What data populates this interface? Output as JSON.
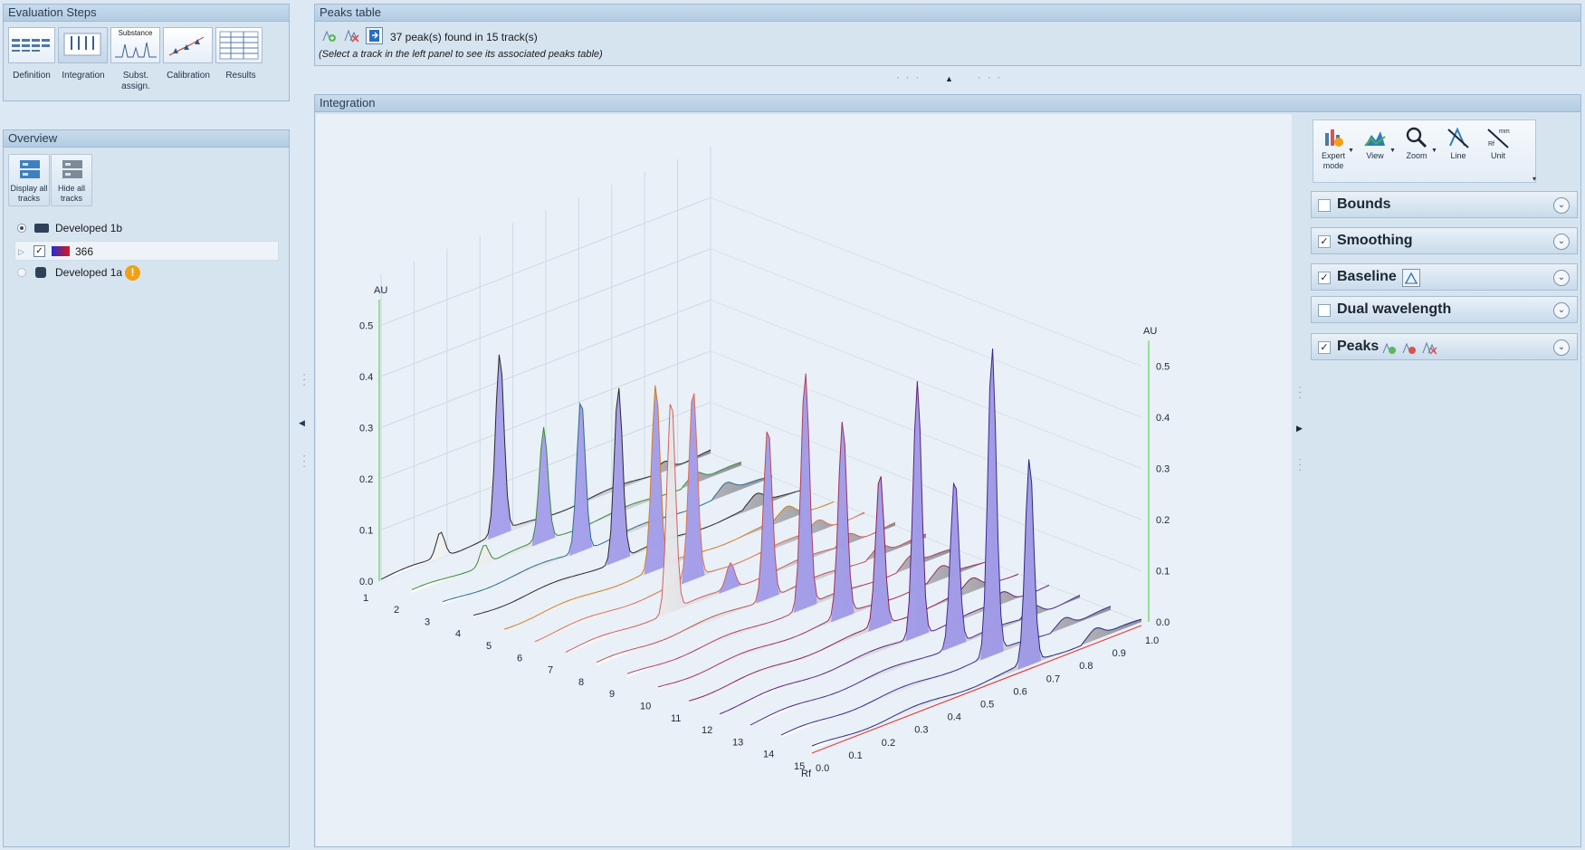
{
  "eval": {
    "title": "Evaluation Steps",
    "steps": [
      "Definition",
      "Integration",
      "Subst.\nassign.",
      "Calibration",
      "Results"
    ],
    "substance_caption": "Substance"
  },
  "overview": {
    "title": "Overview",
    "display_all": "Display all tracks",
    "hide_all": "Hide all tracks",
    "tree": [
      {
        "label": "Developed 1b",
        "selected": true
      },
      {
        "label": "366",
        "checked": true
      },
      {
        "label": "Developed 1a",
        "warning": true
      }
    ]
  },
  "peaks_table": {
    "title": "Peaks table",
    "status": "37 peak(s) found in 15 track(s)",
    "hint": "(Select a track in the left panel to see its associated peaks table)"
  },
  "integration": {
    "title": "Integration",
    "toolbar": [
      "Expert mode",
      "View",
      "Zoom",
      "Line",
      "Unit"
    ],
    "unit_icon_top": "mm",
    "unit_icon_bottom": "Rf",
    "sections": [
      {
        "label": "Bounds",
        "checked": false
      },
      {
        "label": "Smoothing",
        "checked": true
      },
      {
        "label": "Baseline",
        "checked": true
      },
      {
        "label": "Dual wavelength",
        "checked": false
      },
      {
        "label": "Peaks",
        "checked": true
      }
    ]
  },
  "chart_data": {
    "type": "area",
    "title": "",
    "xlabel": "Rf",
    "ylabel": "AU",
    "x_ticks": [
      "0.0",
      "0.1",
      "0.2",
      "0.3",
      "0.4",
      "0.5",
      "0.6",
      "0.7",
      "0.8",
      "0.9",
      "1.0"
    ],
    "y_ticks_left": [
      "0.0",
      "0.1",
      "0.2",
      "0.3",
      "0.4",
      "0.5"
    ],
    "y_ticks_right": [
      "0.0",
      "0.1",
      "0.2",
      "0.3",
      "0.4",
      "0.5"
    ],
    "tracks": [
      "1",
      "2",
      "3",
      "4",
      "5",
      "6",
      "7",
      "8",
      "9",
      "10",
      "11",
      "12",
      "13",
      "14",
      "15"
    ],
    "peak_heights_au": [
      [
        0.05,
        0.35
      ],
      [
        0.04,
        0.22
      ],
      [
        0.3
      ],
      [
        0.34
      ],
      [
        0.36
      ],
      [
        0.37
      ],
      [
        0.42,
        0.05
      ],
      [
        0.34
      ],
      [
        0.46
      ],
      [
        0.38
      ],
      [
        0.3
      ],
      [
        0.5
      ],
      [
        0.33
      ],
      [
        0.6
      ],
      [
        0.4
      ]
    ]
  }
}
